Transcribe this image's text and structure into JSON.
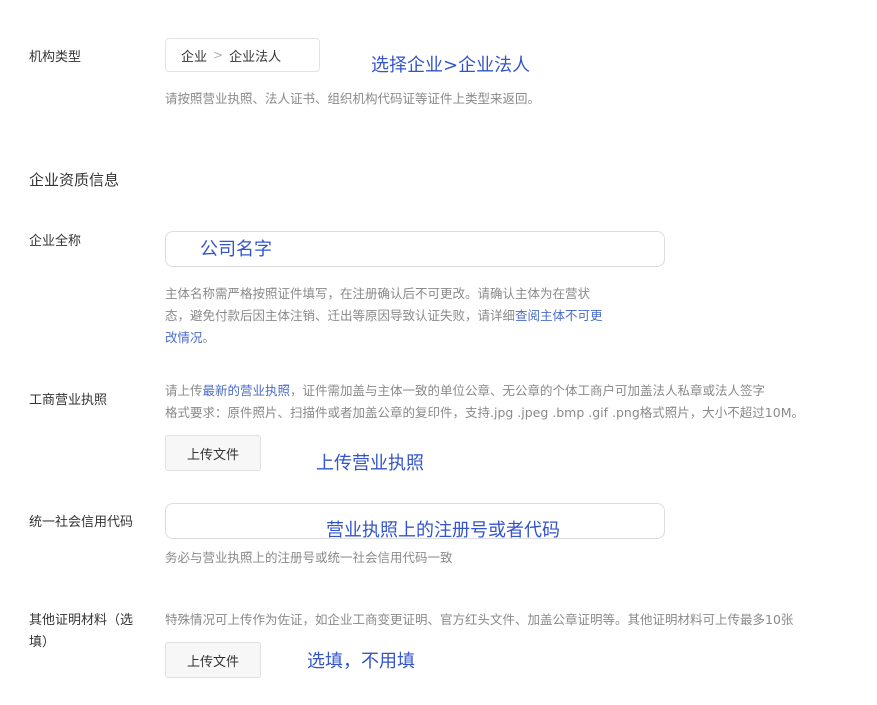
{
  "org_type": {
    "label": "机构类型",
    "selected_level1": "企业",
    "separator": ">",
    "selected_level2": "企业法人",
    "hint": "请按照营业执照、法人证书、组织机构代码证等证件上类型来返回。",
    "annotation": "选择企业>企业法人"
  },
  "section_title": "企业资质信息",
  "company_name": {
    "label": "企业全称",
    "annotation": "公司名字",
    "hint_line1": "主体名称需严格按照证件填写，在注册确认后不可更改。请确认主体为在营状",
    "hint_line2_text": "态，避免付款后因主体注销、迁出等原因导致认证失败，请详细",
    "hint_line2_link": "查阅主体不可更",
    "hint_line3_link": "改情况",
    "hint_line3_text": "。"
  },
  "business_license": {
    "label": "工商营业执照",
    "hint_line1_prefix": "请上传",
    "hint_line1_link": "最新的营业执照",
    "hint_line1_suffix": "，证件需加盖与主体一致的单位公章、无公章的个体工商户可加盖法人私章或法人签字",
    "hint_line2": "格式要求：原件照片、扫描件或者加盖公章的复印件，支持.jpg .jpeg .bmp .gif .png格式照片，大小不超过10M。",
    "upload_label": "上传文件",
    "annotation": "上传营业执照"
  },
  "credit_code": {
    "label": "统一社会信用代码",
    "annotation": "营业执照上的注册号或者代码",
    "hint": "务必与营业执照上的注册号或统一社会信用代码一致"
  },
  "other_materials": {
    "label_line1": "其他证明材料（选",
    "label_line2": "填）",
    "hint": "特殊情况可上传作为佐证，如企业工商变更证明、官方红头文件、加盖公章证明等。其他证明材料可上传最多10张",
    "upload_label": "上传文件",
    "annotation": "选填，不用填"
  },
  "colors": {
    "annotation": "#3355cc",
    "hint": "#8a8a8a",
    "link": "#4a6cc9",
    "border": "#dcdcdc"
  }
}
